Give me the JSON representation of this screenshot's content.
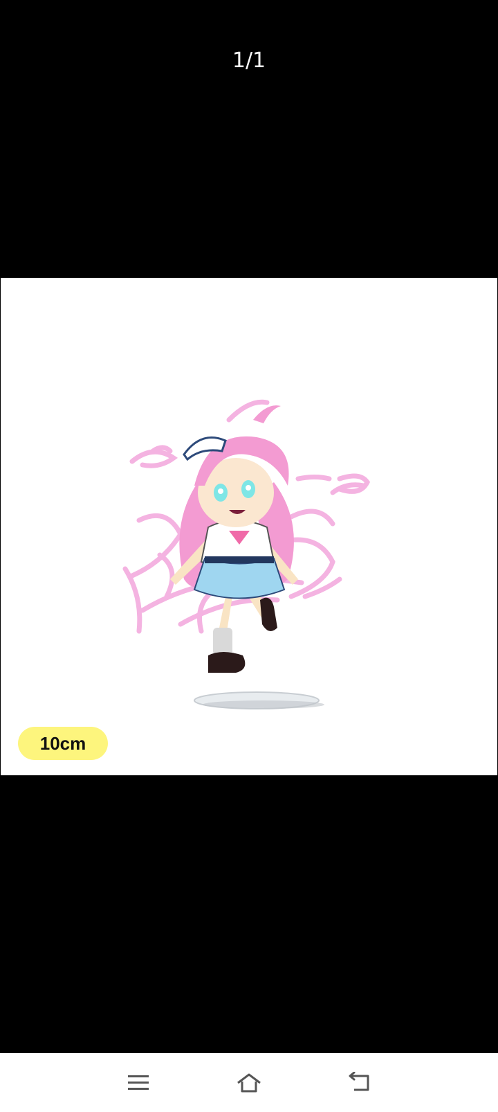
{
  "viewer": {
    "counter": "1/1",
    "size_badge": "10cm",
    "badge_color": "#fdf57d"
  },
  "navbar": {
    "icons": [
      "menu-icon",
      "home-icon",
      "back-icon"
    ]
  }
}
